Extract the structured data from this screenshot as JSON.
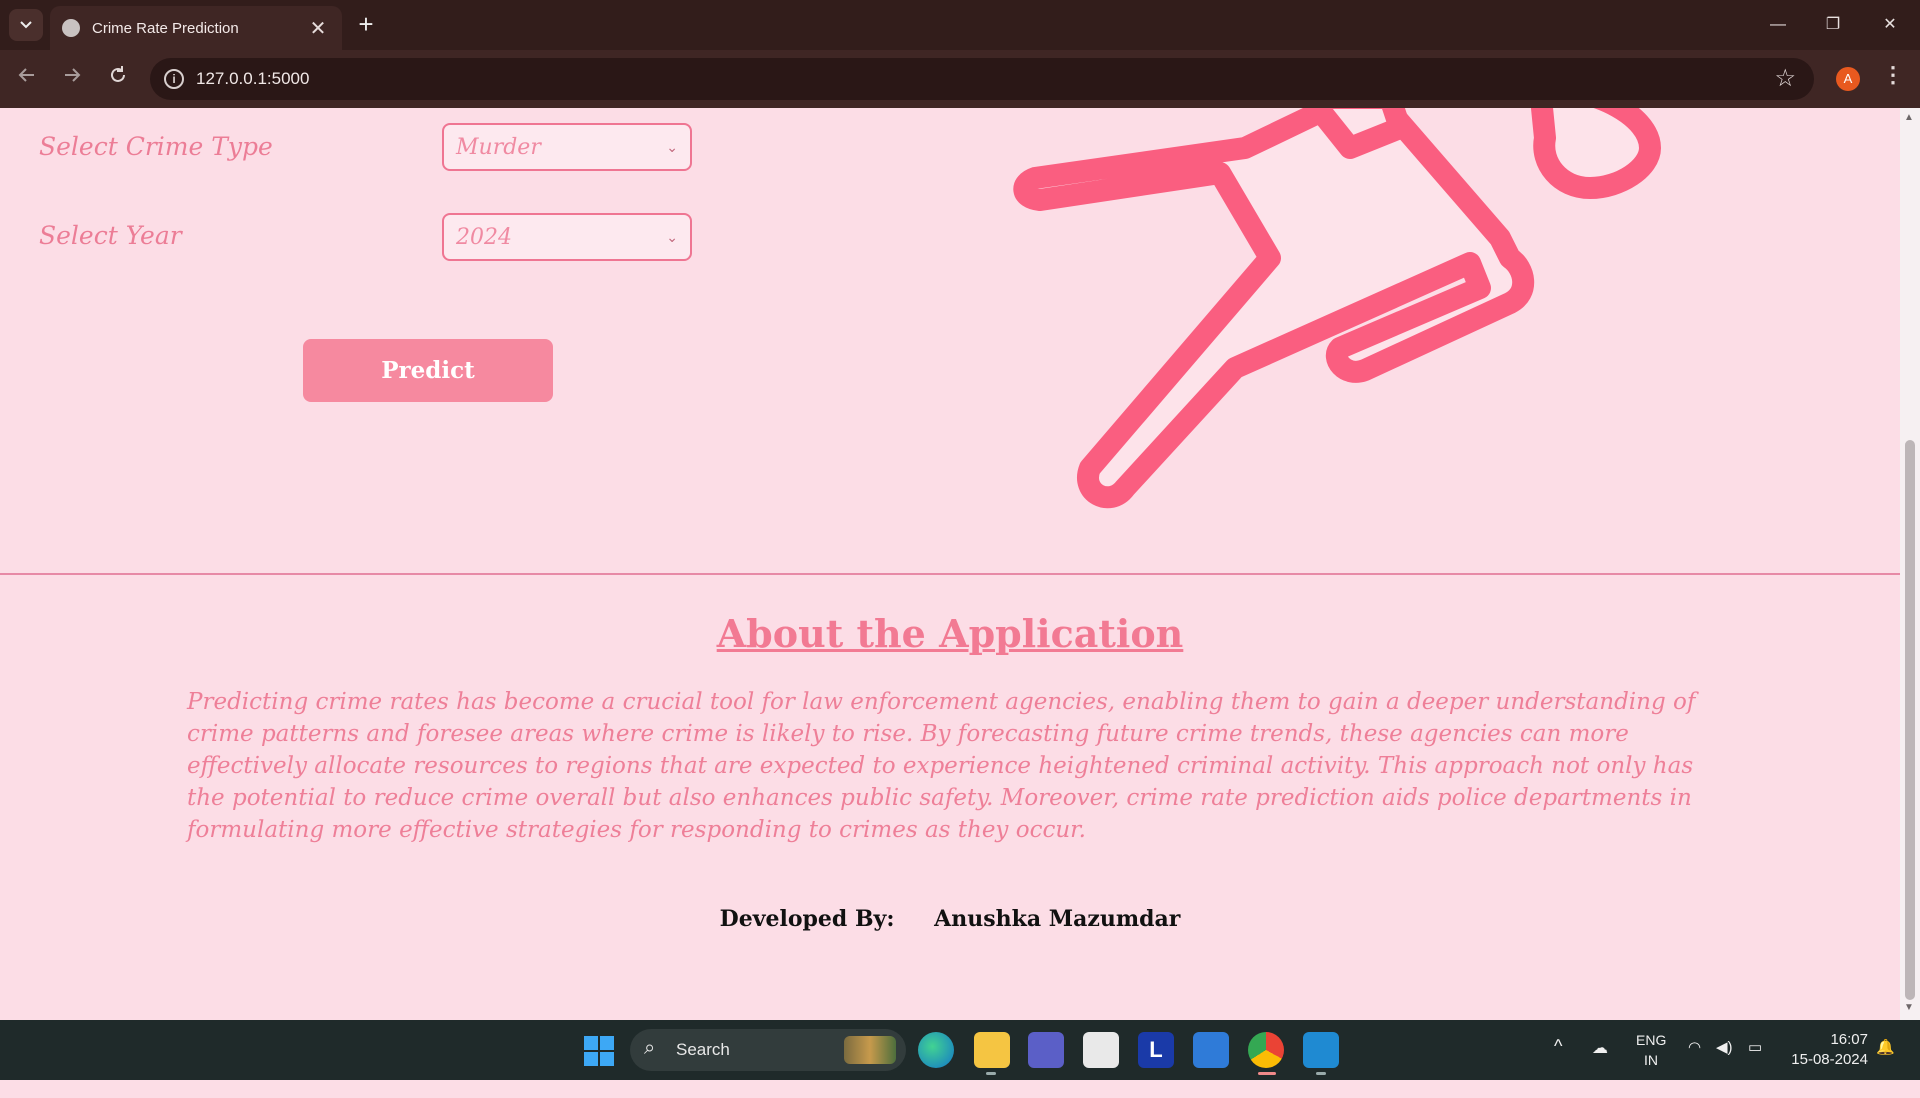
{
  "browser": {
    "tab_title": "Crime Rate Prediction",
    "tab_close": "✕",
    "new_tab": "+",
    "url": "127.0.0.1:5000",
    "profile_initial": "A",
    "window": {
      "minimize": "—",
      "restore": "❐",
      "close": "✕"
    }
  },
  "form": {
    "crime_type_label": "Select Crime Type",
    "crime_type_value": "Murder",
    "year_label": "Select Year",
    "year_value": "2024",
    "predict_label": "Predict"
  },
  "about": {
    "title": "About the Application",
    "text": "Predicting crime rates has become a crucial tool for law enforcement agencies, enabling them to gain a deeper understanding of crime patterns and foresee areas where crime is likely to rise. By forecasting future crime trends, these agencies can more effectively allocate resources to regions that are expected to experience heightened criminal activity. This approach not only has the potential to reduce crime overall but also enhances public safety. Moreover, crime rate prediction aids police departments in formulating more effective strategies for responding to crimes as they occur."
  },
  "footer": {
    "developed_by_label": "Developed By:",
    "developer_name": "Anushka Mazumdar"
  },
  "taskbar": {
    "search_label": "Search",
    "lang_line1": "ENG",
    "lang_line2": "IN",
    "time": "16:07",
    "date": "15-08-2024",
    "apps": [
      "edge-icon",
      "file-explorer-icon",
      "teams-icon",
      "store-icon",
      "l-app-icon",
      "pen-app-icon",
      "chrome-icon",
      "vscode-icon"
    ]
  },
  "colors": {
    "page_bg": "#fcdde6",
    "accent_pink": "#f27a93",
    "illustration_stroke": "#fa5e80",
    "button_bg": "#f6899f"
  }
}
